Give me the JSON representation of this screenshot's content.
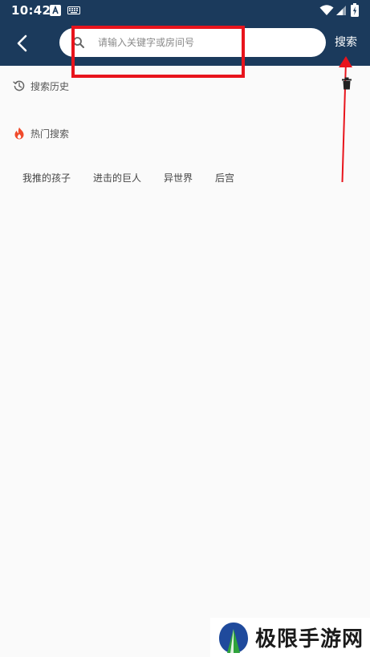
{
  "status_bar": {
    "time": "10:42",
    "icons": [
      "app-a-icon",
      "keyboard-icon",
      "wifi-icon",
      "signal-icon",
      "battery-icon"
    ]
  },
  "header": {
    "back_icon": "chevron-left-icon",
    "search": {
      "placeholder": "请输入关键字或房间号",
      "value": ""
    },
    "search_button_label": "搜索"
  },
  "history": {
    "title": "搜索历史",
    "icon": "history-icon",
    "clear_icon": "trash-icon"
  },
  "hot": {
    "title": "热门搜索",
    "icon": "fire-icon",
    "tags": [
      "我推的孩子",
      "进击的巨人",
      "异世界",
      "后宫"
    ]
  },
  "watermark": {
    "text": "极限手游网"
  },
  "colors": {
    "appbar": "#1b3a5c",
    "annotation": "#e8141c",
    "fire": "#f04a2b",
    "background": "#fafafa"
  }
}
